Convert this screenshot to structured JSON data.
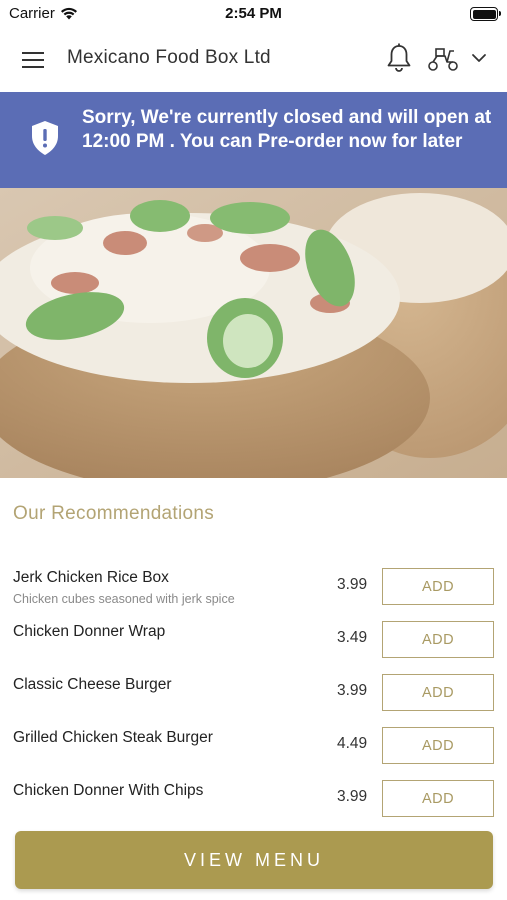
{
  "status_bar": {
    "carrier": "Carrier",
    "time": "2:54 PM",
    "icons": [
      "wifi-icon",
      "battery-icon"
    ]
  },
  "header": {
    "title": "Mexicano Food Box Ltd",
    "icons": [
      "hamburger-menu-icon",
      "bell-icon",
      "scooter-delivery-icon",
      "chevron-down-icon"
    ]
  },
  "banner": {
    "message": "Sorry, We're currently closed and will open at 12:00 PM . You can Pre-order now for later",
    "icon": "shield-alert-icon",
    "background_color": "#5b6db5"
  },
  "hero": {
    "description_icon": "food-photo"
  },
  "recommendations": {
    "title": "Our Recommendations",
    "add_label": "ADD",
    "items": [
      {
        "name": "Jerk Chicken Rice Box",
        "description": "Chicken cubes seasoned with jerk spice",
        "price": "3.99"
      },
      {
        "name": "Chicken Donner Wrap",
        "description": "",
        "price": "3.49"
      },
      {
        "name": "Classic Cheese Burger",
        "description": "",
        "price": "3.99"
      },
      {
        "name": "Grilled Chicken Steak Burger",
        "description": "",
        "price": "4.49"
      },
      {
        "name": "Chicken Donner With Chips",
        "description": "",
        "price": "3.99"
      }
    ]
  },
  "footer": {
    "view_menu_label": "VIEW MENU",
    "accent_color": "#ab9a50"
  }
}
